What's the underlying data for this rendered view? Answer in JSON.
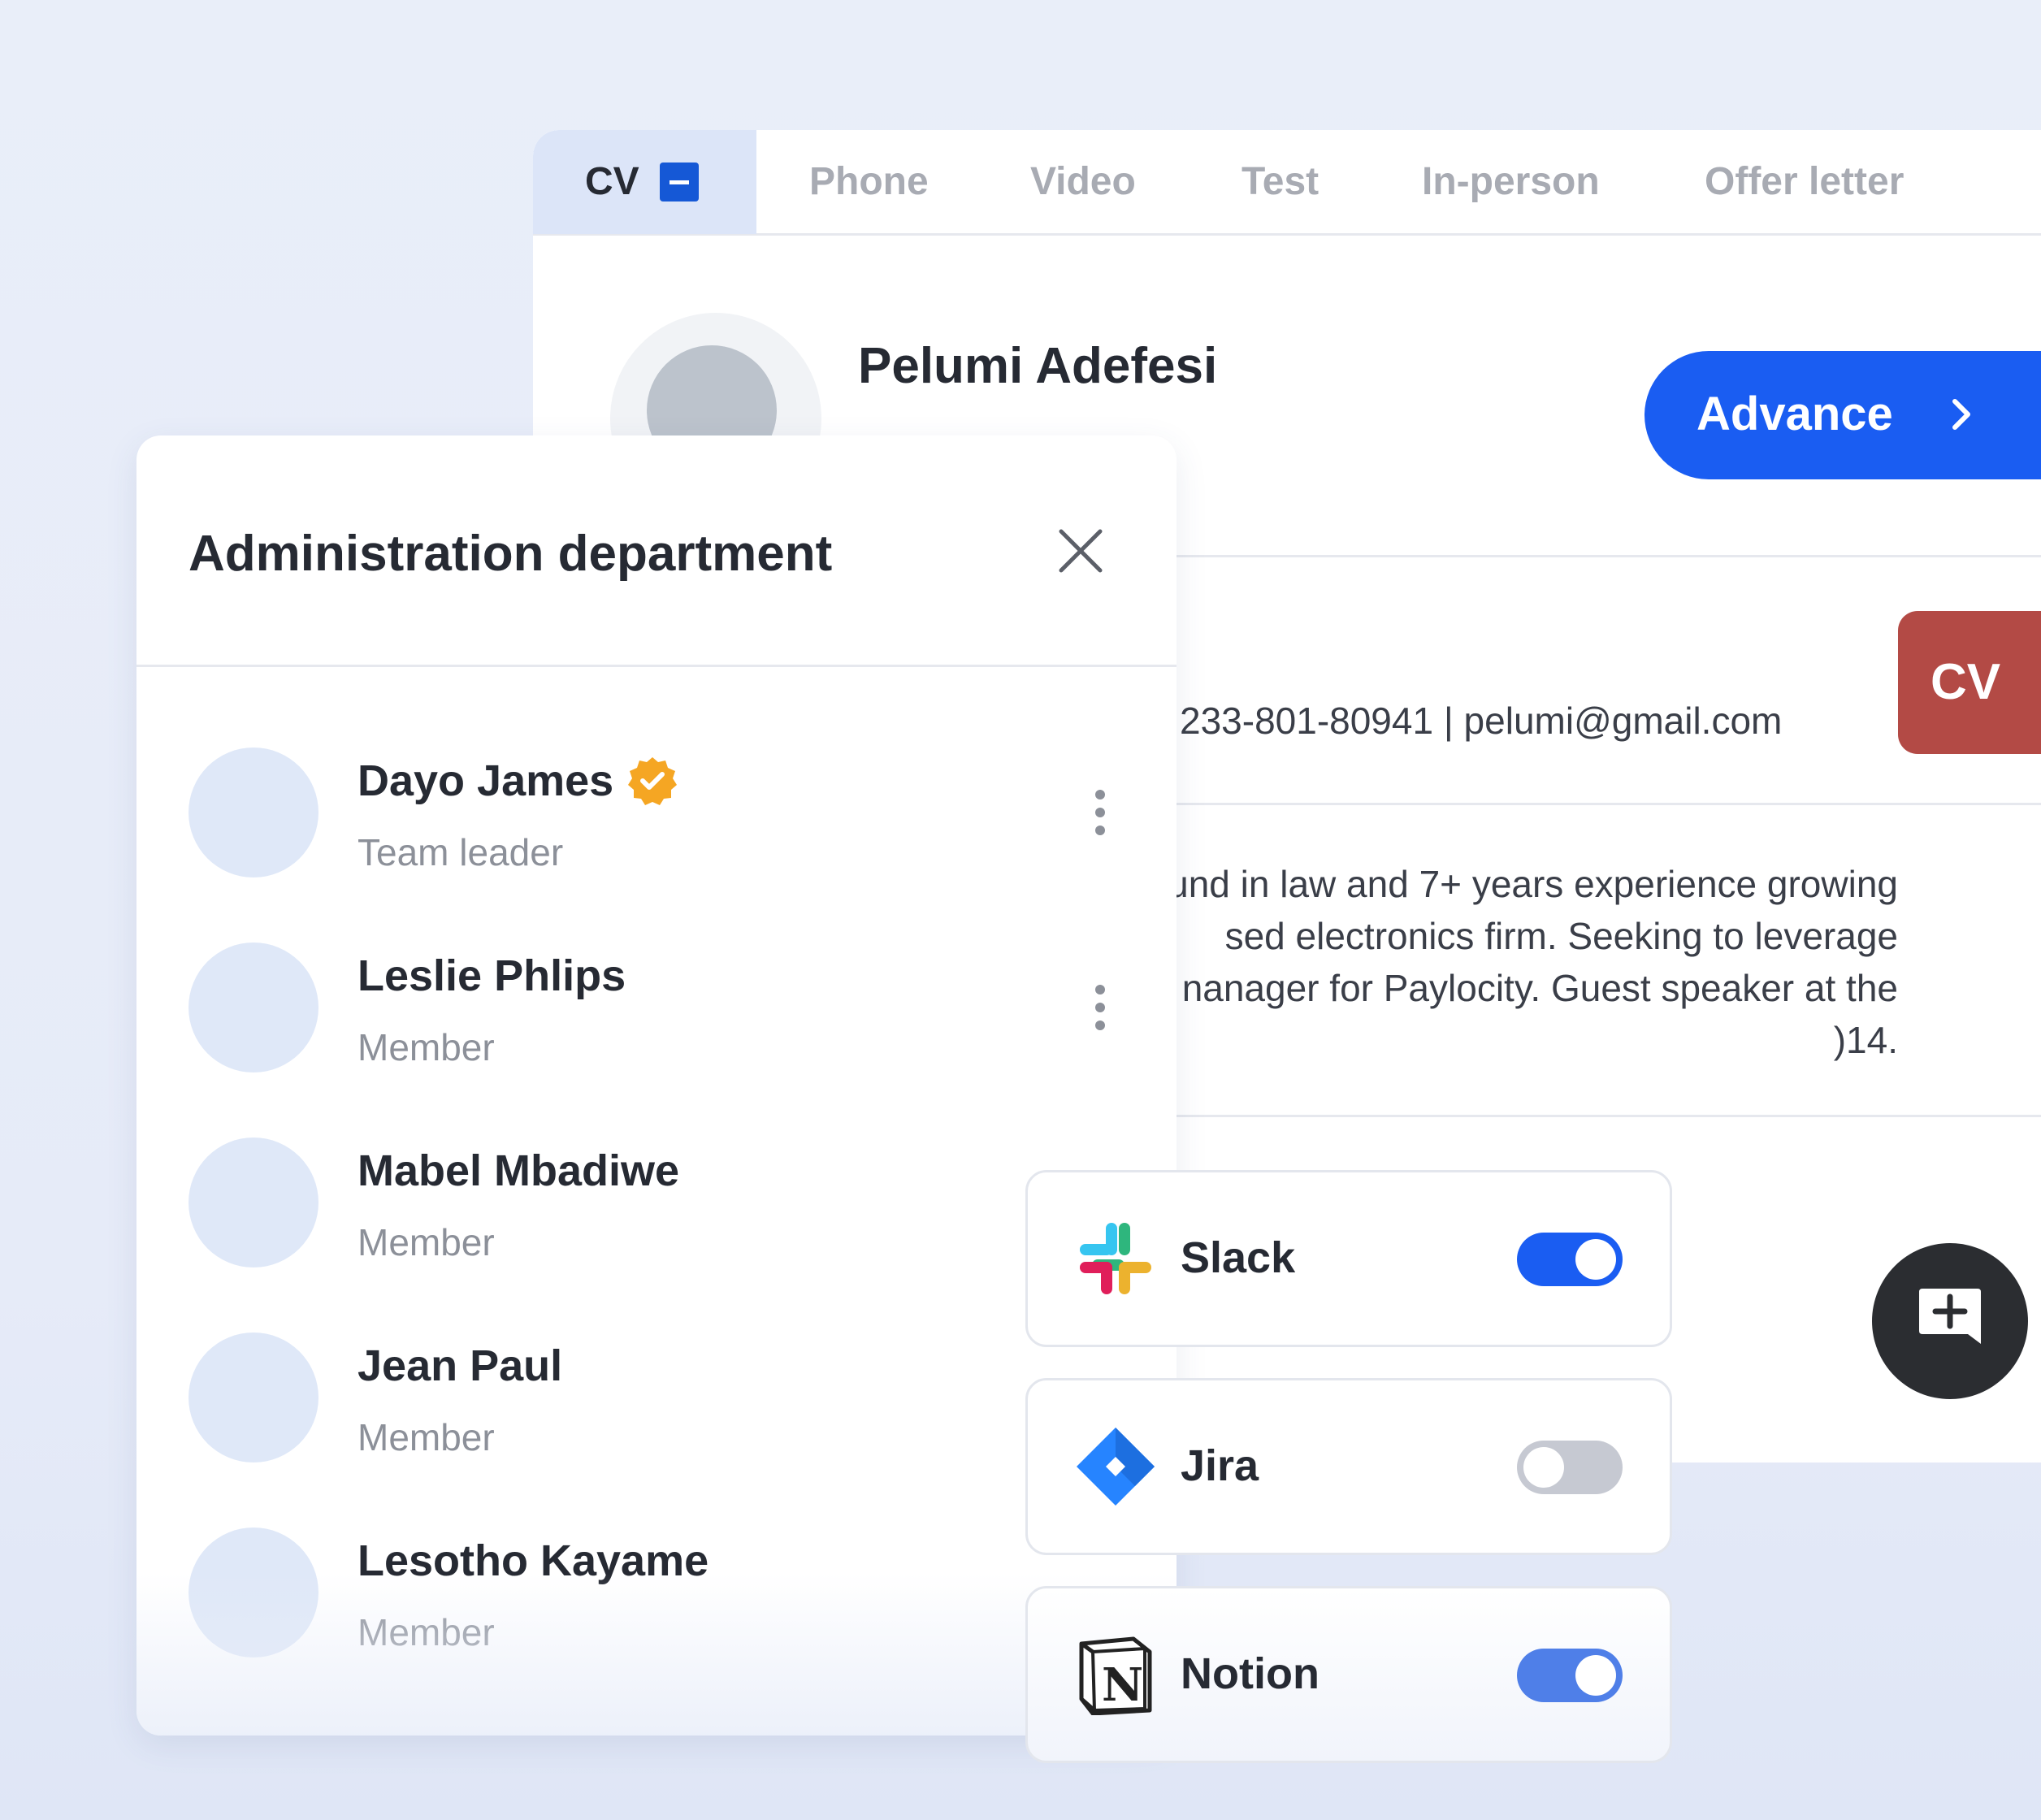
{
  "tabs": [
    {
      "label": "CV",
      "active": true
    },
    {
      "label": "Phone",
      "active": false
    },
    {
      "label": "Video",
      "active": false
    },
    {
      "label": "Test",
      "active": false
    },
    {
      "label": "In-person",
      "active": false
    },
    {
      "label": "Offer letter",
      "active": false
    }
  ],
  "candidate": {
    "name": "Pelumi Adefesi",
    "advance_label": "Advance",
    "contact": "233-801-80941  |  pelumi@gmail.com",
    "cv_badge": "CV",
    "summary_lines": [
      "ound in law and 7+ years experience growing",
      "sed electronics firm. Seeking to leverage",
      "nanager for Paylocity. Guest speaker at the",
      ")14."
    ]
  },
  "department": {
    "title": "Administration department",
    "members": [
      {
        "name": "Dayo James",
        "role": "Team leader",
        "verified": true
      },
      {
        "name": "Leslie Phlips",
        "role": "Member",
        "verified": false
      },
      {
        "name": "Mabel Mbadiwe",
        "role": "Member",
        "verified": false
      },
      {
        "name": "Jean Paul",
        "role": "Member",
        "verified": false
      },
      {
        "name": "Lesotho Kayame",
        "role": "Member",
        "verified": false
      }
    ]
  },
  "integrations": [
    {
      "name": "Slack",
      "enabled": true,
      "icon": "slack-logo"
    },
    {
      "name": "Jira",
      "enabled": false,
      "icon": "jira-logo"
    },
    {
      "name": "Notion",
      "enabled": true,
      "icon": "notion-logo"
    }
  ],
  "colors": {
    "accent": "#1a5df2",
    "cv_badge": "#b34a45",
    "verified": "#f5a623",
    "background": "#e9eef9"
  }
}
